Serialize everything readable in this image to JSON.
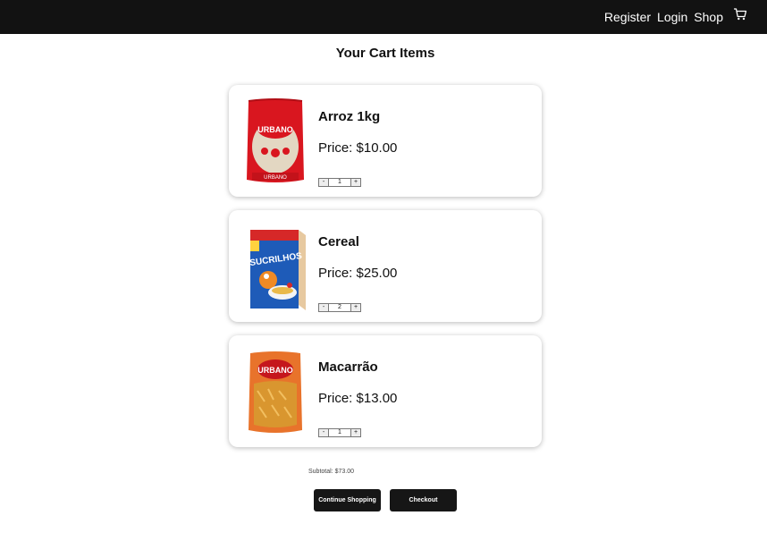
{
  "nav": {
    "links": [
      "Register",
      "Login",
      "Shop"
    ],
    "cart_icon": "shopping-cart-icon"
  },
  "page": {
    "title": "Your Cart Items"
  },
  "cart": {
    "items": [
      {
        "name": "Arroz 1kg",
        "price": "Price: $10.00",
        "quantity": "1",
        "image": "rice-package",
        "brand": "URBANO"
      },
      {
        "name": "Cereal",
        "price": "Price: $25.00",
        "quantity": "2",
        "image": "cereal-box",
        "brand": "SUCRILHOS"
      },
      {
        "name": "Macarrão",
        "price": "Price: $13.00",
        "quantity": "1",
        "image": "pasta-package",
        "brand": "URBANO"
      }
    ],
    "minus_label": "-",
    "plus_label": "+",
    "subtotal": "Subtotal: $73.00"
  },
  "actions": {
    "continue_label": "Continue Shopping",
    "checkout_label": "Checkout"
  },
  "colors": {
    "navbar": "#121212",
    "button": "#161616",
    "background": "#ffffff"
  }
}
